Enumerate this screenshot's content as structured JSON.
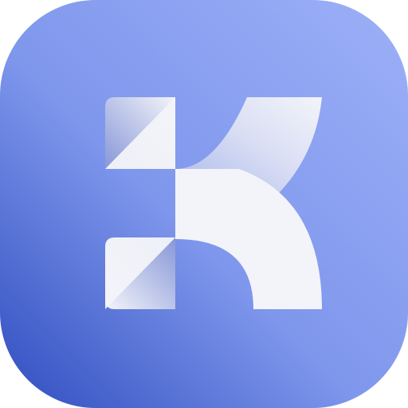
{
  "app_icon": {
    "name": "k-logo-icon",
    "colors": {
      "tile_top_right": "#9db0f8",
      "tile_mid": "#7f97ec",
      "tile_bottom_left": "#2f4dbf",
      "glyph_light": "#f3f4f9",
      "glyph_fade": "#c9d1ef",
      "glyph_shadow": "#8797d8"
    }
  }
}
